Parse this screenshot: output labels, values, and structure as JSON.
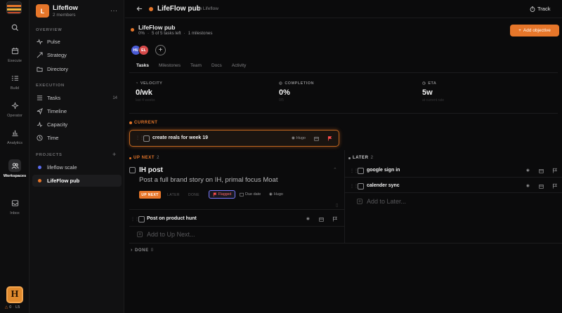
{
  "rail": {
    "items": [
      {
        "label": ""
      },
      {
        "label": "Execute"
      },
      {
        "label": "Build"
      },
      {
        "label": "Operator"
      },
      {
        "label": "Analytics"
      },
      {
        "label": "Workspaces"
      },
      {
        "label": "Inbox"
      }
    ],
    "avatar_letter": "H",
    "footer_count": "0",
    "footer_level": "L5"
  },
  "sidebar": {
    "badge": "L",
    "name": "Lifeflow",
    "members": "2 members",
    "more": "···",
    "overview_header": "OVERVIEW",
    "overview": [
      {
        "label": "Pulse",
        "icon": "pulse-icon"
      },
      {
        "label": "Strategy",
        "icon": "strategy-icon"
      },
      {
        "label": "Directory",
        "icon": "directory-icon"
      }
    ],
    "execution_header": "EXECUTION",
    "execution": [
      {
        "label": "Tasks",
        "count": "14",
        "icon": "tasks-icon"
      },
      {
        "label": "Timeline",
        "icon": "timeline-icon"
      },
      {
        "label": "Capacity",
        "icon": "capacity-icon"
      },
      {
        "label": "Time",
        "icon": "clock-icon"
      }
    ],
    "projects_header": "PROJECTS",
    "projects": [
      {
        "label": "lifeflow scale",
        "color": "#5b6cf0"
      },
      {
        "label": "LifeFlow pub",
        "color": "#e6762a"
      }
    ]
  },
  "header": {
    "title": "LifeFlow pub",
    "in_label": "in Lifeflow",
    "track_label": "Track"
  },
  "project": {
    "name": "LifeFlow pub",
    "percent": "0%",
    "tasks_left": "5 of 5 tasks left",
    "milestones": "1 milestones",
    "add_objective": "Add objective",
    "members": [
      {
        "initials": "HU",
        "color": "#4a5bd6"
      },
      {
        "initials": "EL",
        "color": "#d64a4a"
      }
    ]
  },
  "tabs": [
    "Tasks",
    "Milestones",
    "Team",
    "Docs",
    "Activity"
  ],
  "stats": [
    {
      "label": "VELOCITY",
      "value": "0/wk",
      "sub": "last 4 weeks"
    },
    {
      "label": "COMPLETION",
      "value": "0%",
      "sub": "0/5"
    },
    {
      "label": "ETA",
      "value": "5w",
      "sub": "at current rate"
    }
  ],
  "current": {
    "header": "CURRENT",
    "task": "create reals for week 19",
    "assignee": "Hugo"
  },
  "upnext": {
    "header": "UP NEXT",
    "count": "2",
    "expanded": {
      "title": "IH post",
      "description": "Post a full brand story on IH, primal focus Moat",
      "status_up_next": "UP NEXT",
      "status_later": "LATER",
      "status_done": "DONE",
      "flag_label": "Flagged",
      "due_label": "Due date",
      "assignee": "Hugo"
    },
    "task2": "Post on product hunt",
    "add_label": "Add to Up Next..."
  },
  "later": {
    "header": "LATER",
    "count": "2",
    "tasks": [
      "google sign in",
      "calender sync"
    ],
    "add_label": "Add to Later..."
  },
  "done": {
    "header": "DONE",
    "count": "0"
  },
  "colors": {
    "accent": "#e6762a",
    "flag": "#ff4d4d"
  }
}
